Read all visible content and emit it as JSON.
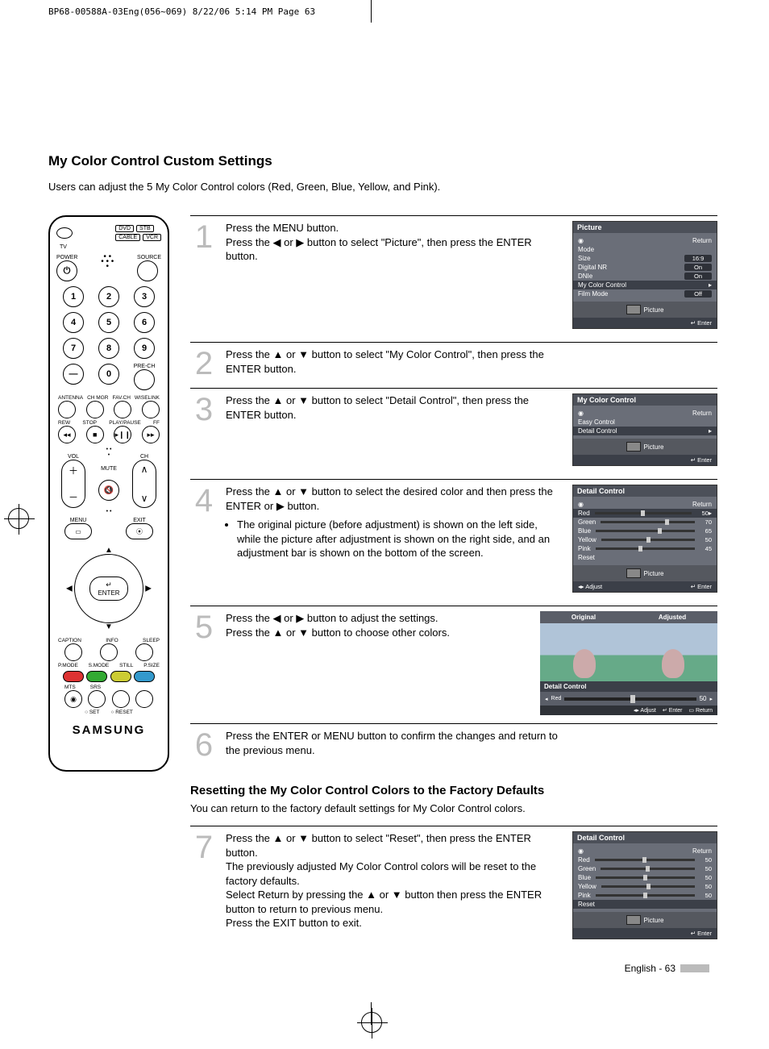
{
  "cropHeader": "BP68-00588A-03Eng(056~069)  8/22/06  5:14 PM  Page 63",
  "title": "My Color Control Custom Settings",
  "intro": "Users can adjust the 5 My Color Control colors (Red, Green, Blue, Yellow, and Pink).",
  "remote": {
    "inputs": {
      "tv": "TV",
      "dvd": "DVD",
      "stb": "STB",
      "cable": "CABLE",
      "vcr": "VCR"
    },
    "power": "POWER",
    "source": "SOURCE",
    "nums": [
      "1",
      "2",
      "3",
      "4",
      "5",
      "6",
      "7",
      "8",
      "9"
    ],
    "dash": "—",
    "zero": "0",
    "prech": "PRE-CH",
    "rowLabels1": [
      "ANTENNA",
      "CH MGR",
      "FAV.CH",
      "WISELINK"
    ],
    "rowLabels2": [
      "REW",
      "STOP",
      "PLAY/PAUSE",
      "FF"
    ],
    "transport": [
      "◂◂",
      "■",
      "▸❙❙",
      "▸▸"
    ],
    "vol": "VOL",
    "mute": "MUTE",
    "ch": "CH",
    "menu": "MENU",
    "exit": "EXIT",
    "enter": "ENTER",
    "enterIcon": "↵",
    "bottom1": [
      "CAPTION",
      "INFO",
      "SLEEP"
    ],
    "bottom2": [
      "P.MODE",
      "S.MODE",
      "STILL",
      "P.SIZE"
    ],
    "bottom3": [
      "MTS",
      "SRS"
    ],
    "setreset": [
      "○ SET",
      "○ RESET"
    ],
    "brand": "SAMSUNG"
  },
  "steps": [
    {
      "n": "1",
      "text": "Press the MENU button.\nPress the ◀ or ▶ button to select \"Picture\", then press  the ENTER button."
    },
    {
      "n": "2",
      "text": "Press the ▲ or ▼ button to select \"My Color Control\", then press the ENTER button."
    },
    {
      "n": "3",
      "text": "Press the ▲ or ▼ button to select \"Detail Control\", then press the ENTER button."
    },
    {
      "n": "4",
      "text": "Press the ▲ or ▼ button to select the desired color and then press the ENTER or ▶ button.",
      "bullet": "The original picture (before adjustment) is shown on the left side, while the picture after adjustment is shown on the right side, and an adjustment bar is shown on the bottom of the screen."
    },
    {
      "n": "5",
      "text": "Press the ◀ or ▶ button to adjust the settings.\nPress the ▲ or ▼ button to choose other colors."
    },
    {
      "n": "6",
      "text": "Press the ENTER or MENU button to confirm the changes and return to the previous menu."
    }
  ],
  "subTitle": "Resetting the My Color Control Colors to the Factory Defaults",
  "subIntro": "You can return to the factory default settings for My Color Control colors.",
  "step7": {
    "n": "7",
    "text": "Press the ▲ or ▼ button to select \"Reset\", then press the ENTER button.\nThe previously adjusted My Color Control colors will be reset to the factory defaults.\nSelect Return by pressing the ▲ or ▼ button then press the ENTER button to return to previous menu.\nPress the EXIT button to exit."
  },
  "osd": {
    "picture": {
      "title": "Picture",
      "return": "Return",
      "mode": "Mode",
      "size": "Size",
      "sizeVal": "16:9",
      "dnr": "Digital NR",
      "dnrVal": "On",
      "dnie": "DNIe",
      "dnieVal": "On",
      "mcc": "My Color Control",
      "film": "Film Mode",
      "filmVal": "Off",
      "picLabel": "Picture",
      "enter": "Enter"
    },
    "mcc": {
      "title": "My Color Control",
      "return": "Return",
      "easy": "Easy Control",
      "detail": "Detail Control",
      "picLabel": "Picture",
      "enter": "Enter"
    },
    "detail": {
      "title": "Detail Control",
      "return": "Return",
      "red": "Red",
      "redVal": "50",
      "green": "Green",
      "greenVal": "70",
      "blue": "Blue",
      "blueVal": "65",
      "yellow": "Yellow",
      "yellowVal": "50",
      "pink": "Pink",
      "pinkVal": "45",
      "reset": "Reset",
      "picLabel": "Picture",
      "adjust": "Adjust",
      "enter": "Enter"
    },
    "detailReset": {
      "title": "Detail Control",
      "return": "Return",
      "red": "Red",
      "green": "Green",
      "blue": "Blue",
      "yellow": "Yellow",
      "pink": "Pink",
      "reset": "Reset",
      "val": "50",
      "picLabel": "Picture",
      "enter": "Enter"
    },
    "preview": {
      "orig": "Original",
      "adj": "Adjusted",
      "dc": "Detail Control",
      "red": "Red",
      "val": "50",
      "adjust": "Adjust",
      "enter": "Enter",
      "return": "Return"
    }
  },
  "footer": "English - 63"
}
